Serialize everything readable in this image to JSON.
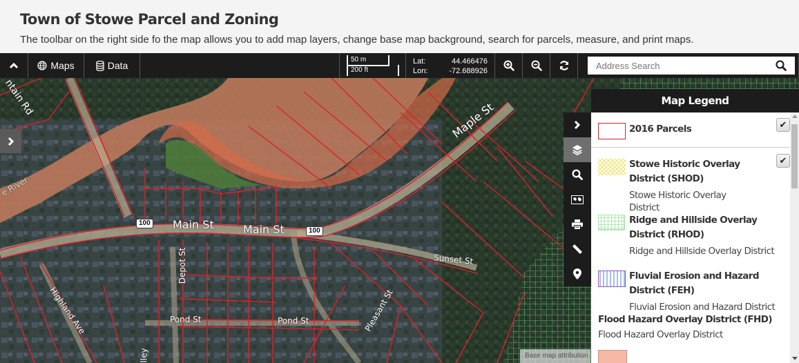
{
  "header": {
    "title": "Town of Stowe Parcel and Zoning",
    "subtitle": "The toolbar on the right side fo the map allows you to add map layers, change base map background, search for parcels, measure, and print maps."
  },
  "toolbar": {
    "collapse_icon": "chevron-up-icon",
    "maps_label": "Maps",
    "maps_icon": "globe-icon",
    "data_label": "Data",
    "data_icon": "database-icon",
    "scale_metric": "50 m",
    "scale_imperial": "200 ft",
    "lat_label": "Lat:",
    "lat_value": "44.466476",
    "lon_label": "Lon:",
    "lon_value": "-72.688926",
    "zoom_in_icon": "zoom-in-icon",
    "zoom_out_icon": "zoom-out-icon",
    "refresh_icon": "refresh-icon",
    "search_placeholder": "Address Search",
    "search_value": "",
    "search_icon": "search-icon"
  },
  "map": {
    "road_labels": {
      "main_st_1": "Main St",
      "main_st_2": "Main St",
      "maple_st": "Maple St",
      "sunset_st": "Sunset St",
      "pond_st_1": "Pond St",
      "pond_st_2": "Pond St",
      "depot_st": "Depot St",
      "highland_ave": "Highland Ave",
      "pleasant_st": "Pleasant St",
      "mountain_rd": "ntain Rd",
      "river": "e River",
      "valley": "lley"
    },
    "route_shield_1": "100",
    "route_shield_2": "100",
    "attribution": "Base map attribution",
    "colors": {
      "parcel_line": "#e0202a",
      "flood_zone": "#c8764f",
      "fluvial_zone": "#d9845a",
      "ridge_grid": "#5fbf6f"
    }
  },
  "side_tools": [
    {
      "name": "collapse-legend",
      "icon": "chevron-right-icon"
    },
    {
      "name": "layers",
      "icon": "layers-icon",
      "active": true
    },
    {
      "name": "zoom-search",
      "icon": "magnify-icon"
    },
    {
      "name": "basemap",
      "icon": "map-icon"
    },
    {
      "name": "print",
      "icon": "printer-icon"
    },
    {
      "name": "measure",
      "icon": "ruler-icon"
    },
    {
      "name": "locate",
      "icon": "map-pin-icon"
    }
  ],
  "legend": {
    "title": "Map Legend",
    "items": [
      {
        "title": "2016 Parcels",
        "description": "",
        "checked": true,
        "swatch": "red-outline"
      },
      {
        "title": "Stowe Historic Overlay District (SHOD)",
        "description": "Stowe Historic Overlay District",
        "checked": true,
        "swatch": "yellow-crosshatch"
      },
      {
        "title": "Ridge and Hillside Overlay District (RHOD)",
        "description": "Ridge and Hillside Overlay District",
        "checked": false,
        "swatch": "green-grid"
      },
      {
        "title": "Fluvial Erosion and Hazard District (FEH)",
        "description": "Fluvial Erosion and Hazard District",
        "checked": false,
        "swatch": "blue-vertical-lines"
      },
      {
        "title": "Flood Hazard Overlay District (FHD)",
        "description": "Flood Hazard Overlay District",
        "checked": false,
        "swatch": "salmon-fill"
      }
    ],
    "colors": {
      "parcels": "#d0242b",
      "shod": "#f2e35a",
      "rhod": "#6ccf6e",
      "feh_lines": "#4a7fd0",
      "feh_border": "#9a4fc0",
      "fhd": "#f5b8a4"
    }
  }
}
